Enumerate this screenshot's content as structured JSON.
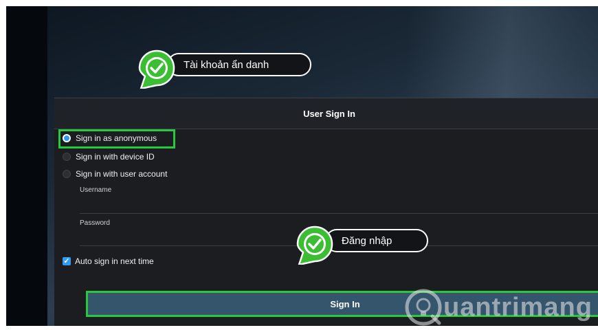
{
  "dialog": {
    "title": "User Sign In",
    "options": [
      {
        "label": "Sign in as anonymous",
        "selected": true
      },
      {
        "label": "Sign in with device ID",
        "selected": false
      },
      {
        "label": "Sign in with user account",
        "selected": false
      }
    ],
    "username_label": "Username",
    "password_label": "Password",
    "auto_sign_in_label": "Auto sign in next time",
    "auto_sign_in_checked": true,
    "sign_in_button": "Sign In"
  },
  "callouts": {
    "anonymous": "Tài khoản ẩn danh",
    "login": "Đăng nhập"
  },
  "watermark": {
    "text": "uantrimang",
    "icon": "lightbulb-icon"
  },
  "colors": {
    "accent_blue": "#2f9bf3",
    "highlight_green": "#27c93f",
    "button_bg": "#34556b",
    "dialog_bg": "#1b1d20"
  }
}
